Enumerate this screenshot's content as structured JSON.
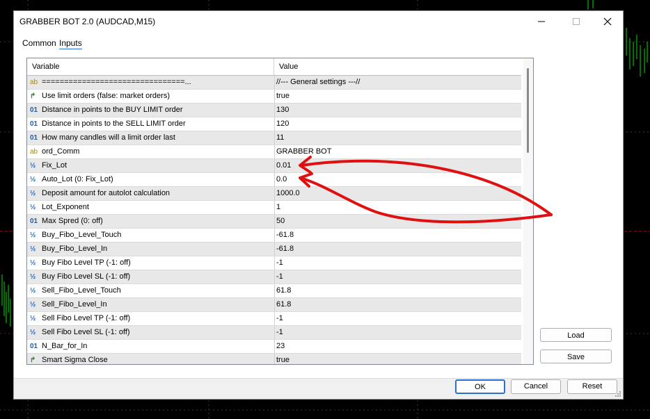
{
  "window": {
    "title": "GRABBER BOT 2.0 (AUDCAD,M15)"
  },
  "tabs": [
    {
      "label": "Common"
    },
    {
      "label": "Inputs"
    }
  ],
  "grid": {
    "header": {
      "variable": "Variable",
      "value": "Value"
    },
    "rows": [
      {
        "icon": "ab",
        "icon_name": "string-icon",
        "variable": "================================...",
        "value": "//--- General settings ---//"
      },
      {
        "icon": "bool",
        "icon_name": "bool-icon",
        "variable": "Use limit orders (false: market orders)",
        "value": "true"
      },
      {
        "icon": "01",
        "icon_name": "int-icon",
        "variable": "Distance in points to the BUY LIMIT order",
        "value": "130"
      },
      {
        "icon": "01",
        "icon_name": "int-icon",
        "variable": "Distance in points to the SELL LIMIT order",
        "value": "120"
      },
      {
        "icon": "01",
        "icon_name": "int-icon",
        "variable": "How many candles will a limit order last",
        "value": "11"
      },
      {
        "icon": "ab",
        "icon_name": "string-icon",
        "variable": "ord_Comm",
        "value": "GRABBER BOT"
      },
      {
        "icon": "half",
        "icon_name": "double-icon",
        "variable": "Fix_Lot",
        "value": "0.01"
      },
      {
        "icon": "half",
        "icon_name": "double-icon",
        "variable": "Auto_Lot (0: Fix_Lot)",
        "value": "0.0"
      },
      {
        "icon": "half",
        "icon_name": "double-icon",
        "variable": "Deposit amount for autolot calculation",
        "value": "1000.0"
      },
      {
        "icon": "half",
        "icon_name": "double-icon",
        "variable": "Lot_Exponent",
        "value": "1"
      },
      {
        "icon": "01",
        "icon_name": "int-icon",
        "variable": "Max Spred (0: off)",
        "value": "50"
      },
      {
        "icon": "half",
        "icon_name": "double-icon",
        "variable": "Buy_Fibo_Level_Touch",
        "value": "-61.8"
      },
      {
        "icon": "half",
        "icon_name": "double-icon",
        "variable": "Buy_Fibo_Level_In",
        "value": "-61.8"
      },
      {
        "icon": "half",
        "icon_name": "double-icon",
        "variable": "Buy Fibo Level TP (-1: off)",
        "value": "-1"
      },
      {
        "icon": "half",
        "icon_name": "double-icon",
        "variable": "Buy Fibo Level SL (-1: off)",
        "value": "-1"
      },
      {
        "icon": "half",
        "icon_name": "double-icon",
        "variable": "Sell_Fibo_Level_Touch",
        "value": "61.8"
      },
      {
        "icon": "half",
        "icon_name": "double-icon",
        "variable": "Sell_Fibo_Level_In",
        "value": "61.8"
      },
      {
        "icon": "half",
        "icon_name": "double-icon",
        "variable": "Sell Fibo Level TP (-1: off)",
        "value": "-1"
      },
      {
        "icon": "half",
        "icon_name": "double-icon",
        "variable": "Sell Fibo Level SL (-1: off)",
        "value": "-1"
      },
      {
        "icon": "01",
        "icon_name": "int-icon",
        "variable": "N_Bar_for_In",
        "value": "23"
      },
      {
        "icon": "bool",
        "icon_name": "bool-icon",
        "variable": "Smart Sigma Close",
        "value": "true"
      }
    ]
  },
  "buttons": {
    "load": "Load",
    "save": "Save",
    "ok": "OK",
    "cancel": "Cancel",
    "reset": "Reset"
  },
  "colors": {
    "annotation": "#e01010",
    "accent": "#2a6fd6",
    "chart_candles": "#00e000"
  }
}
